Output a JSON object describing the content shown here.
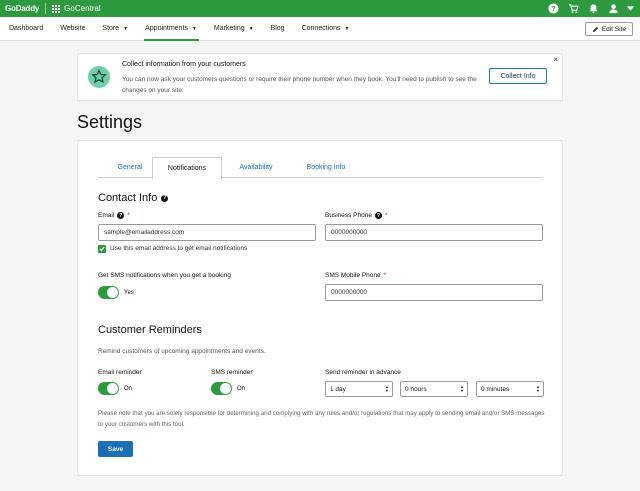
{
  "topbar": {
    "brand": "GoDaddy",
    "product": "GoCentral",
    "icons": [
      "help-icon",
      "cart-icon",
      "bell-icon",
      "user-icon"
    ]
  },
  "nav": {
    "items": [
      {
        "label": "Dashboard"
      },
      {
        "label": "Website"
      },
      {
        "label": "Store"
      },
      {
        "label": "Appointments"
      },
      {
        "label": "Marketing"
      },
      {
        "label": "Blog"
      },
      {
        "label": "Connections"
      }
    ],
    "active": "Appointments",
    "edit_site": "Edit Site"
  },
  "banner": {
    "title": "Collect information from your customers",
    "text": "You can now ask your customers questions or require their phone number when they book. You'll need to publish to see the changes on your site.",
    "button": "Collect Info",
    "close": "×"
  },
  "page": {
    "title": "Settings"
  },
  "tabs": [
    {
      "label": "General"
    },
    {
      "label": "Notifications"
    },
    {
      "label": "Availability"
    },
    {
      "label": "Booking Info"
    }
  ],
  "contact": {
    "title": "Contact Info",
    "email_label": "Email",
    "email_value": "sample@emailaddress.com",
    "email_notify_label": "Use this email address to get email notifications",
    "business_phone_label": "Business Phone",
    "business_phone_value": "0000000000",
    "sms_notify_label": "Get SMS notifications when you get a booking",
    "sms_toggle_text": "Yes",
    "sms_mobile_label": "SMS Mobile Phone",
    "sms_mobile_value": "0000000000"
  },
  "reminders": {
    "title": "Customer Reminders",
    "description": "Remind customers of upcoming appointments and events.",
    "email_label": "Email reminder",
    "email_toggle_text": "On",
    "sms_label": "SMS reminder",
    "sms_toggle_text": "On",
    "advance_label": "Send reminder in advance",
    "days": "1 day",
    "hours": "0 hours",
    "minutes": "0 minutes",
    "note": "Please note that you are solely responsible for determining and complying with any rules and/or regulations that may apply to sending email and/or SMS messages to your customers with this tool.",
    "save": "Save"
  },
  "colors": {
    "brand_green": "#2d9a3f",
    "link_blue": "#1a6fb5",
    "required_red": "#c00"
  }
}
